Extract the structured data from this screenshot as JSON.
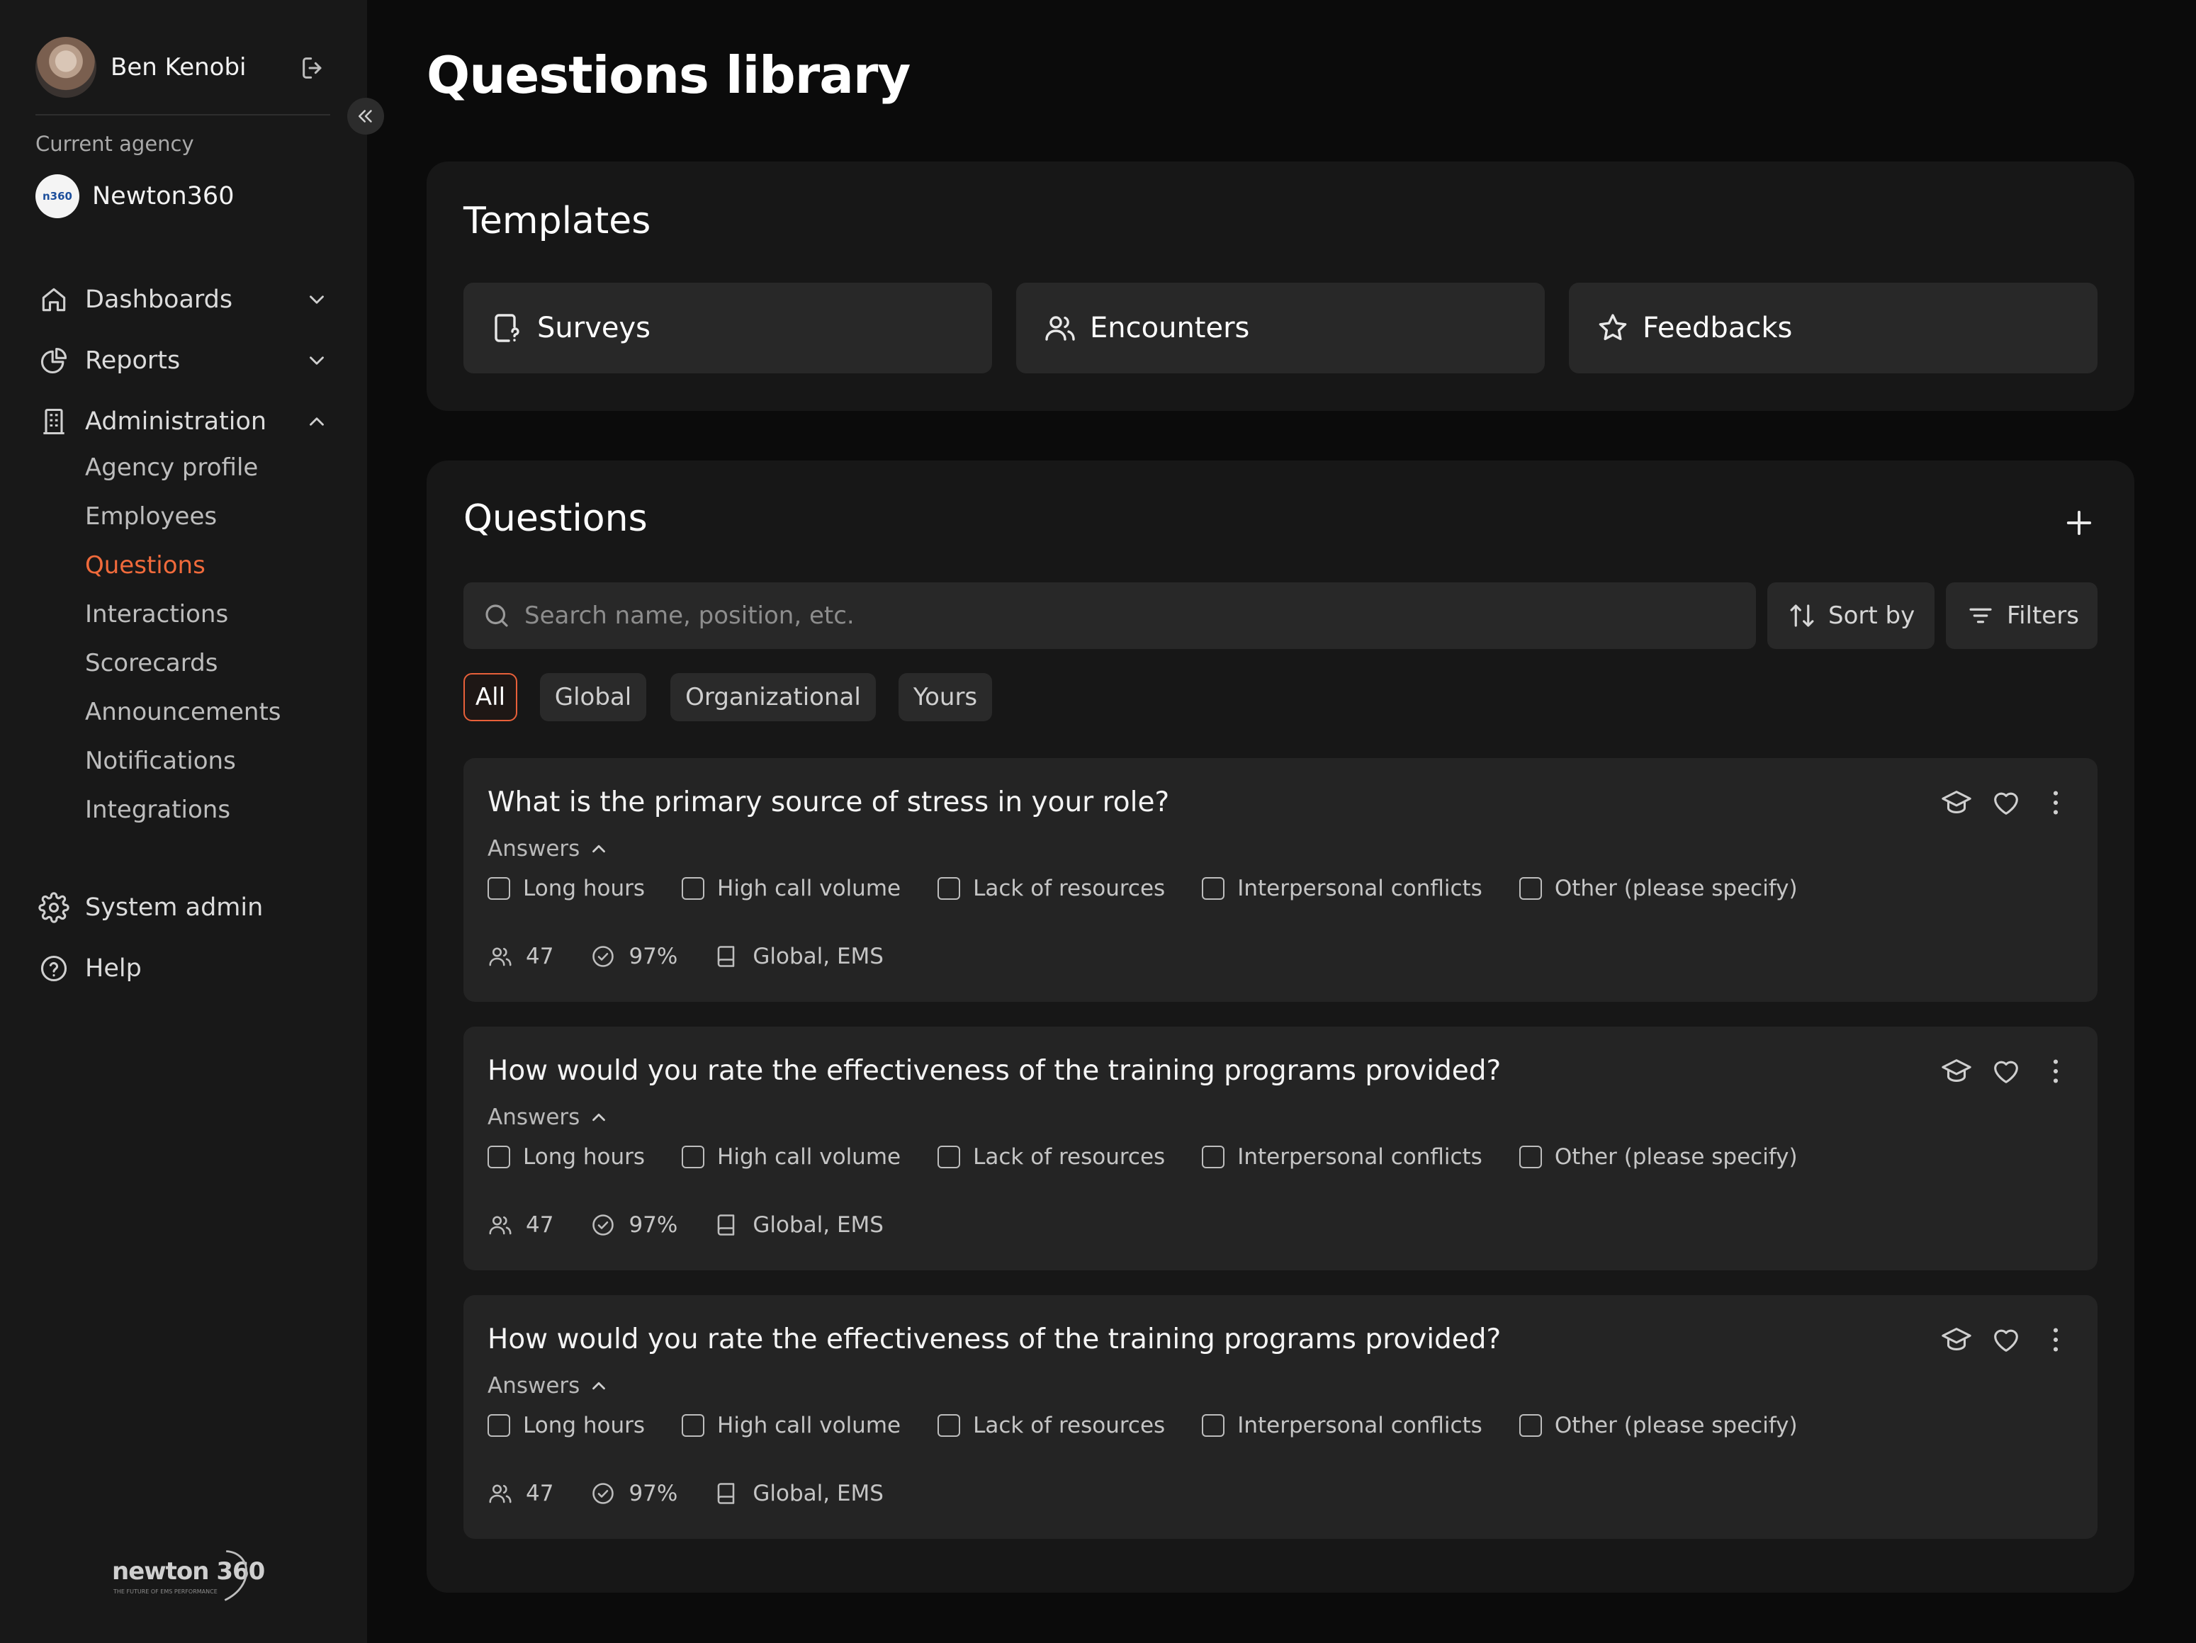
{
  "user": {
    "name": "Ben Kenobi"
  },
  "agency": {
    "caption": "Current agency",
    "name": "Newton360",
    "logo_text": "n360"
  },
  "nav": {
    "dashboards": "Dashboards",
    "reports": "Reports",
    "administration": "Administration",
    "admin_items": [
      "Agency profile",
      "Employees",
      "Questions",
      "Interactions",
      "Scorecards",
      "Announcements",
      "Notifications",
      "Integrations"
    ],
    "active_item": "Questions",
    "system_admin": "System admin",
    "help": "Help"
  },
  "brand": {
    "name": "newton 360",
    "tagline": "THE FUTURE OF EMS PERFORMANCE"
  },
  "page": {
    "title": "Questions library"
  },
  "templates": {
    "title": "Templates",
    "items": [
      {
        "label": "Surveys",
        "icon": "survey-icon"
      },
      {
        "label": "Encounters",
        "icon": "users-icon"
      },
      {
        "label": "Feedbacks",
        "icon": "star-icon"
      }
    ]
  },
  "questions": {
    "title": "Questions",
    "search_placeholder": "Search name, position, etc.",
    "sort_label": "Sort by",
    "filters_label": "Filters",
    "tabs": [
      "All",
      "Global",
      "Organizational",
      "Yours"
    ],
    "active_tab": "All",
    "items": [
      {
        "title": "What is the primary source of stress in your role?",
        "answers_label": "Answers",
        "answers": [
          "Long hours",
          "High call volume",
          "Lack of resources",
          "Interpersonal conflicts",
          "Other (please specify)"
        ],
        "responses": "47",
        "completion": "97%",
        "scope": "Global, EMS"
      },
      {
        "title": "How would you rate the effectiveness of the training programs provided?",
        "answers_label": "Answers",
        "answers": [
          "Long hours",
          "High call volume",
          "Lack of resources",
          "Interpersonal conflicts",
          "Other (please specify)"
        ],
        "responses": "47",
        "completion": "97%",
        "scope": "Global, EMS"
      },
      {
        "title": "How would you rate the effectiveness of the training programs provided?",
        "answers_label": "Answers",
        "answers": [
          "Long hours",
          "High call volume",
          "Lack of resources",
          "Interpersonal conflicts",
          "Other (please specify)"
        ],
        "responses": "47",
        "completion": "97%",
        "scope": "Global, EMS"
      }
    ]
  },
  "colors": {
    "accent": "#f06a3b",
    "background": "#0b0b0b",
    "sidebar": "#181818",
    "panel": "#171717",
    "card": "#242424"
  }
}
